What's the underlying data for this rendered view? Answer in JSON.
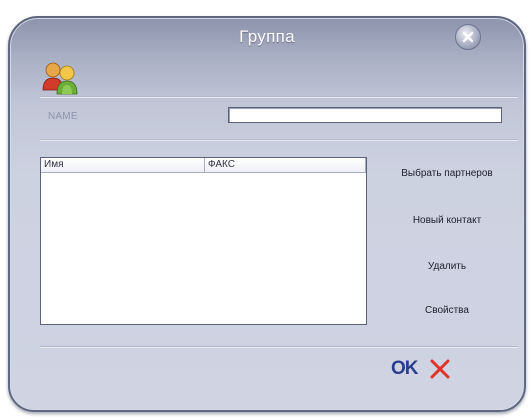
{
  "dialog": {
    "title": "Группа"
  },
  "form": {
    "name_label": "NAME",
    "name_value": ""
  },
  "members_table": {
    "columns": [
      "Имя",
      "ФАКС"
    ],
    "rows": []
  },
  "actions": {
    "select_partners": "Выбрать партнеров",
    "new_contact": "Новый контакт",
    "delete": "Удалить",
    "properties": "Свойства"
  },
  "footer": {
    "ok_label": "OK"
  },
  "icons": {
    "close": "close-icon",
    "group": "group-icon",
    "cancel": "cancel-icon"
  },
  "colors": {
    "window": "#cfd3e2",
    "ok_text": "#2a3d8f",
    "cancel_x": "#e0322b"
  }
}
